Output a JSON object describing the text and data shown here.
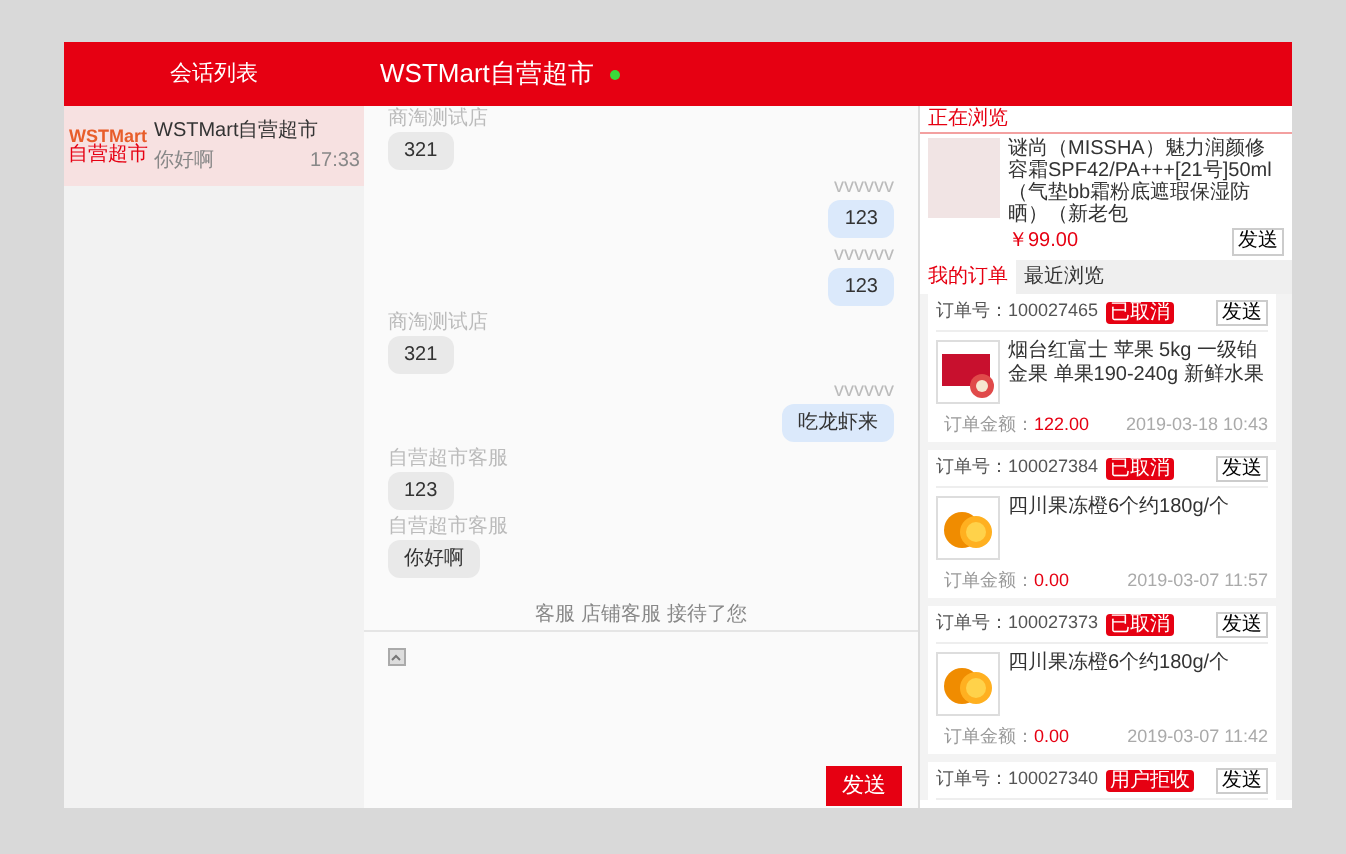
{
  "header": {
    "list_title": "会话列表",
    "chat_title": "WSTMart自营超市",
    "online": true
  },
  "conversations": [
    {
      "logo_top": "WSTMart",
      "logo_bottom": "自营超市",
      "name": "WSTMart自营超市",
      "preview": "你好啊",
      "time": "17:33",
      "selected": true
    }
  ],
  "messages": [
    {
      "kind": "received",
      "sender": "商淘测试店",
      "text": "321"
    },
    {
      "kind": "sent",
      "sender": "vvvvvv",
      "text": "123"
    },
    {
      "kind": "sent",
      "sender": "vvvvvv",
      "text": "123"
    },
    {
      "kind": "received",
      "sender": "商淘测试店",
      "text": "321"
    },
    {
      "kind": "sent",
      "sender": "vvvvvv",
      "text": "吃龙虾来"
    },
    {
      "kind": "received",
      "sender": "自营超市客服",
      "text": "123"
    },
    {
      "kind": "received",
      "sender": "自营超市客服",
      "text": "你好啊"
    },
    {
      "kind": "notice",
      "text": "客服 店铺客服 接待了您"
    }
  ],
  "composer": {
    "send_label": "发送"
  },
  "browsing": {
    "title": "正在浏览",
    "product": "谜尚（MISSHA）魅力润颜修容霜SPF42/PA+++[21号]50ml（气垫bb霜粉底遮瑕保湿防晒）（新老包",
    "price": "￥99.00",
    "send_label": "发送"
  },
  "tabs": [
    {
      "label": "我的订单",
      "selected": true
    },
    {
      "label": "最近浏览",
      "selected": false
    }
  ],
  "orders": [
    {
      "number_label": "订单号：",
      "number": "100027465",
      "status": "已取消",
      "send_label": "发送",
      "kind": "apples",
      "product": "烟台红富士 苹果 5kg 一级铂金果 单果190-240g 新鲜水果",
      "amount_label": "订单金额：",
      "amount": "122.00",
      "date": "2019-03-18 10:43"
    },
    {
      "number_label": "订单号：",
      "number": "100027384",
      "status": "已取消",
      "send_label": "发送",
      "kind": "oranges",
      "product": "四川果冻橙6个约180g/个",
      "amount_label": "订单金额：",
      "amount": "0.00",
      "date": "2019-03-07 11:57"
    },
    {
      "number_label": "订单号：",
      "number": "100027373",
      "status": "已取消",
      "send_label": "发送",
      "kind": "oranges",
      "product": "四川果冻橙6个约180g/个",
      "amount_label": "订单金额：",
      "amount": "0.00",
      "date": "2019-03-07 11:42"
    },
    {
      "number_label": "订单号：",
      "number": "100027340",
      "status": "用户拒收",
      "send_label": "发送"
    }
  ]
}
